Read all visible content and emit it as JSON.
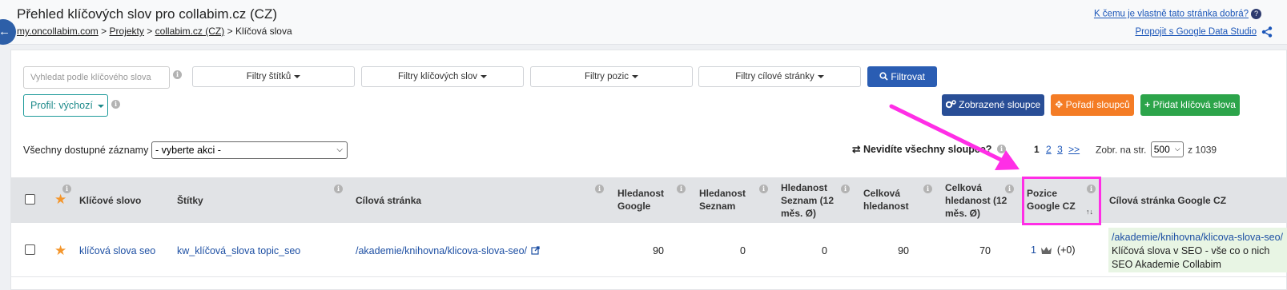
{
  "header": {
    "title": "Přehled klíčových slov pro collabim.cz (CZ)",
    "breadcrumb": {
      "items": [
        "my.oncollabim.com",
        "Projekty",
        "collabim.cz (CZ)"
      ],
      "separator": ">",
      "current": "Klíčová slova"
    },
    "help_link": "K čemu je vlastně tato stránka dobrá?",
    "help_badge": "?",
    "gds_link": "Propojit s Google Data Studio"
  },
  "filters": {
    "search_placeholder": "Vyhledat podle klíčového slova",
    "tags": "Filtry štítků",
    "keywords": "Filtry klíčových slov",
    "positions": "Filtry pozic",
    "landing": "Filtry cílové stránky",
    "submit": "Filtrovat",
    "profile": "Profil: výchozí"
  },
  "actions": {
    "columns": "Zobrazené sloupce",
    "order": "Pořadí sloupců",
    "add": "Přidat klíčová slova"
  },
  "bulk": {
    "label": "Všechny dostupné záznamy",
    "select_value": "- vyberte akci -"
  },
  "columns_hint": "Nevidíte všechny sloupce?",
  "pagination": {
    "current": "1",
    "pages": [
      "2",
      "3"
    ],
    "next": ">>",
    "per_page_label": "Zobr. na str.",
    "per_page_value": "500",
    "total": "z 1039"
  },
  "table": {
    "headers": {
      "keyword": "Klíčové slovo",
      "tags": "Štítky",
      "landing": "Cílová stránka",
      "search_google": "Hledanost Google",
      "search_seznam": "Hledanost Seznam",
      "search_seznam_12": "Hledanost Seznam (12 měs. Ø)",
      "total": "Celková hledanost",
      "total_12": "Celková hledanost (12 měs. Ø)",
      "position": "Pozice Google CZ",
      "landing_google": "Cílová stránka Google CZ"
    },
    "rows": [
      {
        "keyword": "klíčová slova seo",
        "tags": "kw_klíčová_slova topic_seo",
        "landing": "/akademie/knihovna/klicova-slova-seo/",
        "search_google": "90",
        "search_seznam": "0",
        "search_seznam_12": "0",
        "total": "90",
        "total_12": "70",
        "position": "1",
        "position_change": "(+0)",
        "landing_google_url": "/akademie/knihovna/klicova-slova-seo/",
        "landing_google_title1": "Klíčová slova v SEO - vše co o nich",
        "landing_google_title2": "SEO Akademie Collabim"
      }
    ]
  },
  "icons": {
    "back": "arrow-left-icon",
    "info": "info-icon",
    "star": "star-icon",
    "search": "search-icon",
    "gears": "gears-icon",
    "move": "move-icon",
    "plus": "plus-icon",
    "swap": "swap-arrows-icon",
    "share": "share-icon",
    "external": "external-link-icon",
    "crown": "crown-icon",
    "sort": "sort-icon"
  },
  "colors": {
    "primary": "#2a5db3",
    "orange": "#f47c25",
    "green": "#2ca44a",
    "teal": "#1d9a9a",
    "annotation": "#ff2ee6",
    "star": "#f4962c"
  }
}
